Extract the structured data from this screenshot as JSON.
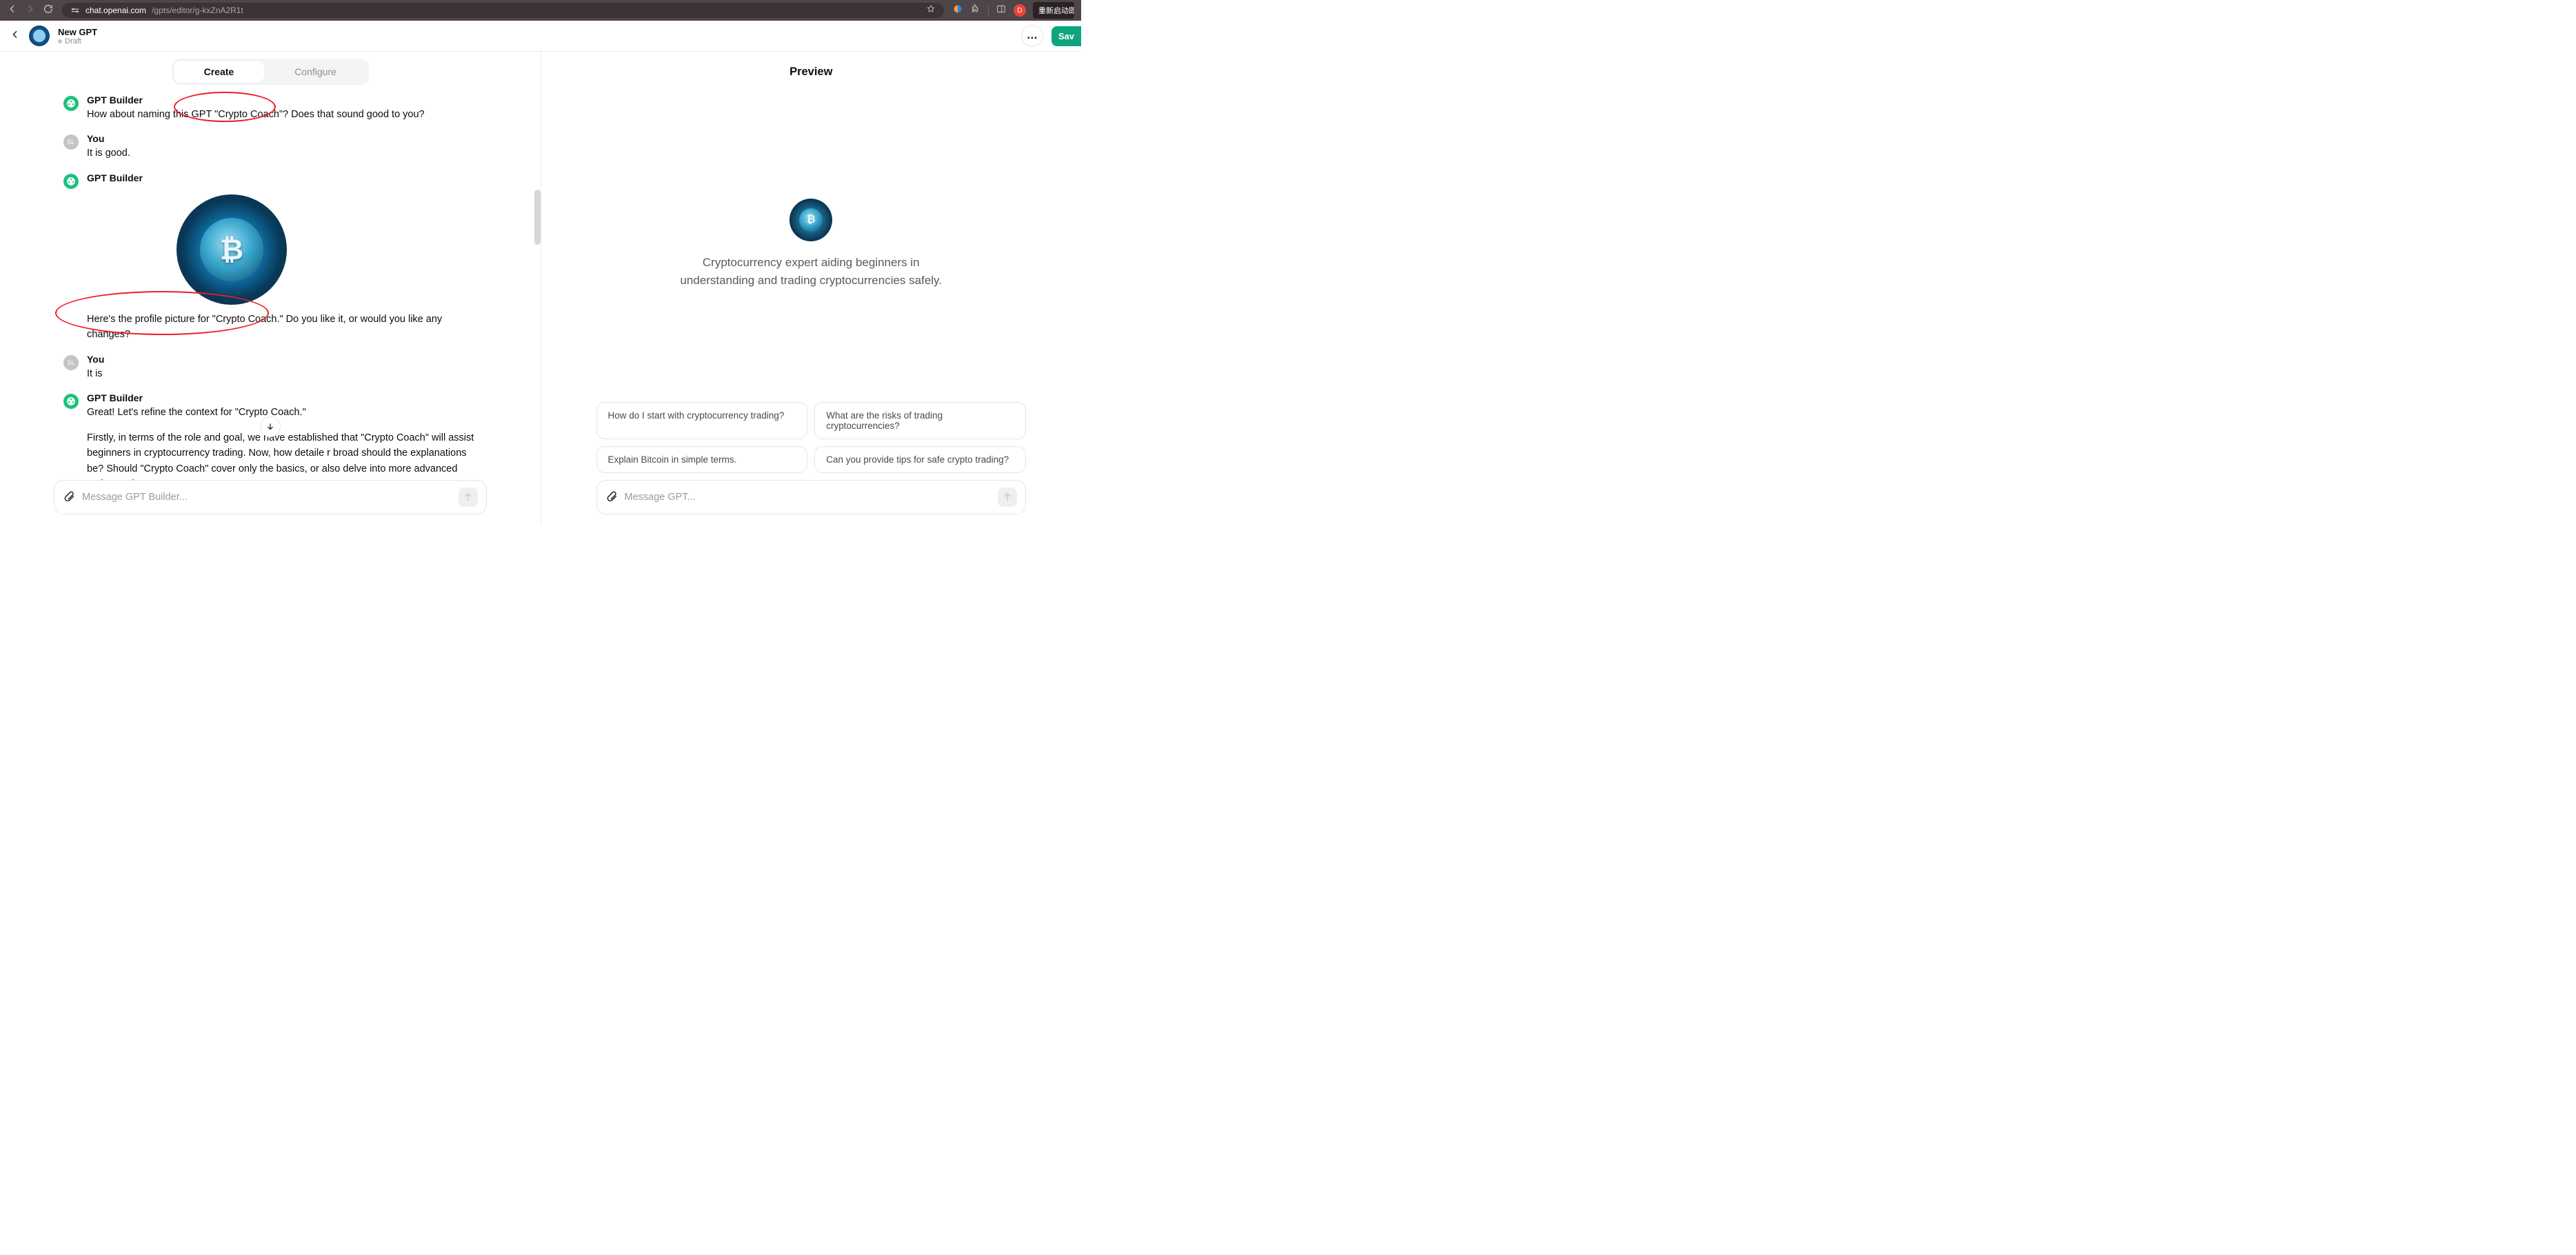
{
  "browser": {
    "url_host": "chat.openai.com",
    "url_path": "/gpts/editor/g-kxZnA2R1t",
    "relaunch_label": "重新启动即可更",
    "user_initial": "D"
  },
  "editor_bar": {
    "title": "New GPT",
    "draft_label": "Draft",
    "more_glyph": "…",
    "save_label": "Sav"
  },
  "tabs": {
    "create": "Create",
    "configure": "Configure"
  },
  "conversation": {
    "builder_name": "GPT Builder",
    "user_name": "You",
    "user_initials": "SL",
    "m1_text": "How about naming this GPT \"Crypto Coach\"? Does that sound good to you?",
    "u1_text": "It is good.",
    "m2_text": "Here's the profile picture for \"Crypto Coach.\" Do you like it, or would you like any changes?",
    "u2_text": "It is",
    "m3_text_a": "Great! Let's refine the context for \"Crypto Coach.\"",
    "m3_text_b": "Firstly, in terms of the role and goal, we have established that \"Crypto Coach\" will assist beginners in cryptocurrency trading. Now, how detaile      r broad should the explanations be? Should \"Crypto Coach\" cover only the basics, or also delve into more advanced topics as the user progresses?"
  },
  "left_input": {
    "placeholder": "Message GPT Builder..."
  },
  "preview": {
    "heading": "Preview",
    "description": "Cryptocurrency expert aiding beginners in understanding and trading cryptocurrencies safely.",
    "suggestions": [
      "How do I start with cryptocurrency trading?",
      "What are the risks of trading cryptocurrencies?",
      "Explain Bitcoin in simple terms.",
      "Can you provide tips for safe crypto trading?"
    ],
    "input_placeholder": "Message GPT..."
  }
}
